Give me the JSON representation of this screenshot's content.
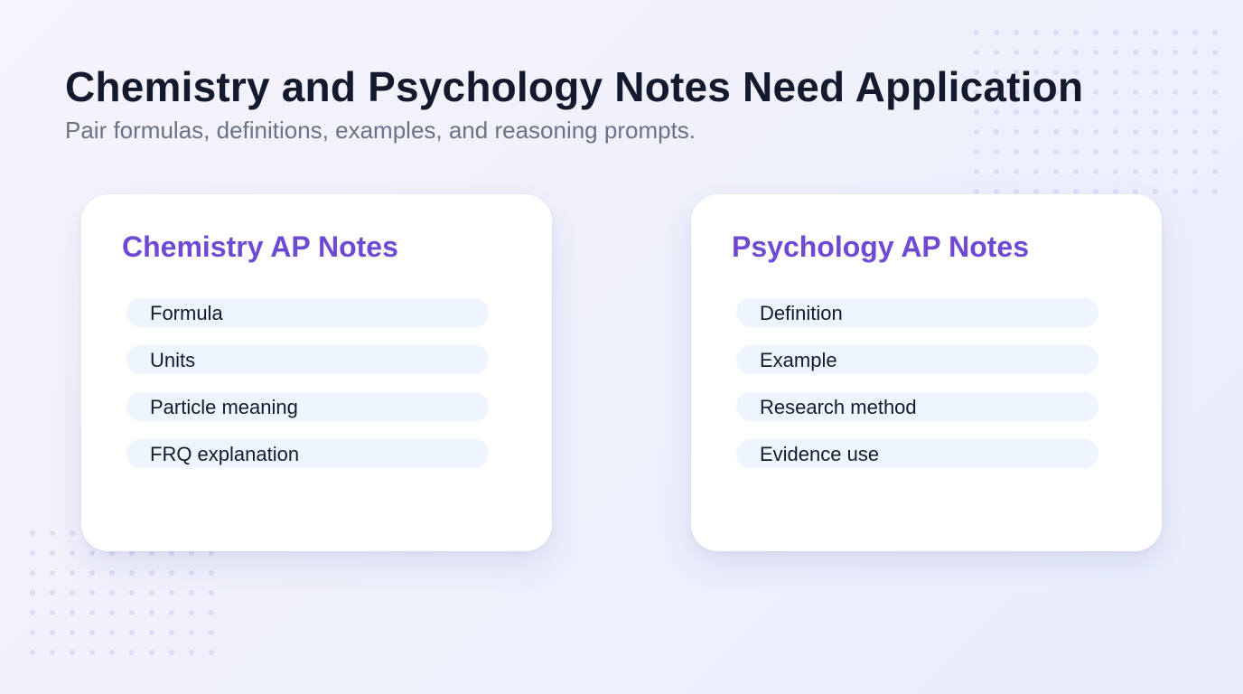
{
  "header": {
    "title": "Chemistry and Psychology Notes Need Application",
    "subtitle": "Pair formulas, definitions, examples, and reasoning prompts."
  },
  "cards": [
    {
      "title": "Chemistry AP Notes",
      "items": [
        "Formula",
        "Units",
        "Particle meaning",
        "FRQ explanation"
      ]
    },
    {
      "title": "Psychology AP Notes",
      "items": [
        "Definition",
        "Example",
        "Research method",
        "Evidence use"
      ]
    }
  ],
  "colors": {
    "heading": "#131a2e",
    "subtitle": "#6a7285",
    "accent": "#6e4ad2",
    "pill": "#eef5fe",
    "dot": "#dcdcf6"
  }
}
